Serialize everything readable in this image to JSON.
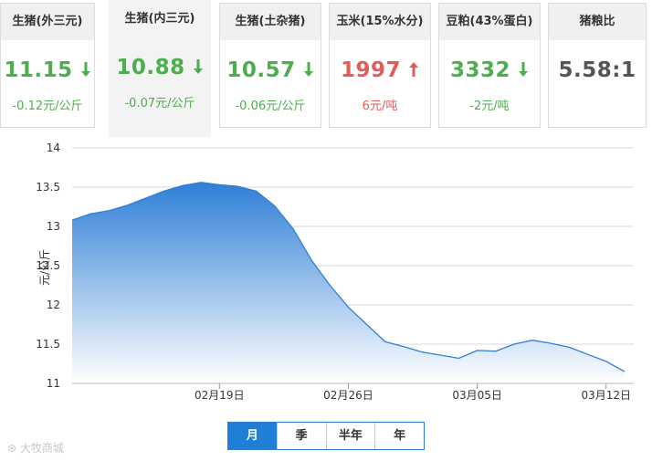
{
  "cards": [
    {
      "title": "生猪(外三元)",
      "value": "11.15",
      "trend": "down",
      "change": "-0.12元/公斤",
      "color": "#4cae4c"
    },
    {
      "title": "生猪(内三元)",
      "value": "10.88",
      "trend": "down",
      "change": "-0.07元/公斤",
      "color": "#4cae4c"
    },
    {
      "title": "生猪(土杂猪)",
      "value": "10.57",
      "trend": "down",
      "change": "-0.06元/公斤",
      "color": "#4cae4c"
    },
    {
      "title": "玉米(15%水分)",
      "value": "1997",
      "trend": "up",
      "change": "6元/吨",
      "color": "#e35b5b"
    },
    {
      "title": "豆粕(43%蛋白)",
      "value": "3332",
      "trend": "down",
      "change": "-2元/吨",
      "color": "#4cae4c"
    },
    {
      "title": "猪粮比",
      "value": "5.58:1",
      "trend": "none",
      "change": "",
      "color": "#555555"
    }
  ],
  "tabs": [
    {
      "label": "月",
      "active": true
    },
    {
      "label": "季",
      "active": false
    },
    {
      "label": "半年",
      "active": false
    },
    {
      "label": "年",
      "active": false
    }
  ],
  "watermark": "大牧商城",
  "chart_data": {
    "type": "area",
    "ylabel": "元/公斤",
    "ylim": [
      11,
      14
    ],
    "yticks": [
      11,
      11.5,
      12,
      12.5,
      13,
      13.5,
      14
    ],
    "xticks": [
      {
        "label": "02月19日",
        "day": 8
      },
      {
        "label": "02月26日",
        "day": 15
      },
      {
        "label": "03月05日",
        "day": 22
      },
      {
        "label": "03月12日",
        "day": 29
      }
    ],
    "x_day_range": [
      0,
      30.5
    ],
    "series": [
      {
        "color": "#2f7fd6",
        "points": [
          {
            "day": 0,
            "value": 13.08
          },
          {
            "day": 1,
            "value": 13.16
          },
          {
            "day": 2,
            "value": 13.2
          },
          {
            "day": 3,
            "value": 13.27
          },
          {
            "day": 4,
            "value": 13.36
          },
          {
            "day": 5,
            "value": 13.45
          },
          {
            "day": 6,
            "value": 13.52
          },
          {
            "day": 7,
            "value": 13.56
          },
          {
            "day": 8,
            "value": 13.53
          },
          {
            "day": 9,
            "value": 13.51
          },
          {
            "day": 10,
            "value": 13.45
          },
          {
            "day": 11,
            "value": 13.26
          },
          {
            "day": 12,
            "value": 12.97
          },
          {
            "day": 13,
            "value": 12.57
          },
          {
            "day": 14,
            "value": 12.25
          },
          {
            "day": 15,
            "value": 11.97
          },
          {
            "day": 16,
            "value": 11.75
          },
          {
            "day": 17,
            "value": 11.53
          },
          {
            "day": 18,
            "value": 11.47
          },
          {
            "day": 19,
            "value": 11.4
          },
          {
            "day": 20,
            "value": 11.36
          },
          {
            "day": 21,
            "value": 11.32
          },
          {
            "day": 22,
            "value": 11.42
          },
          {
            "day": 23,
            "value": 11.41
          },
          {
            "day": 24,
            "value": 11.5
          },
          {
            "day": 25,
            "value": 11.55
          },
          {
            "day": 26,
            "value": 11.51
          },
          {
            "day": 27,
            "value": 11.46
          },
          {
            "day": 28,
            "value": 11.37
          },
          {
            "day": 29,
            "value": 11.28
          },
          {
            "day": 30,
            "value": 11.15
          }
        ]
      }
    ],
    "grid": true
  }
}
